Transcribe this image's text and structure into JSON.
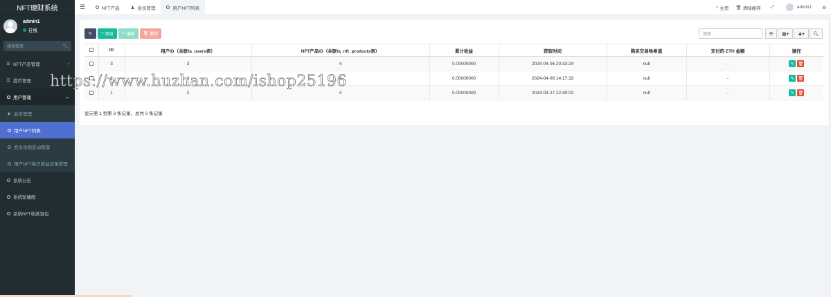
{
  "sidebar": {
    "logo": "NFT理财系统",
    "user": {
      "name": "admin1",
      "status": "在线"
    },
    "search_placeholder": "搜索菜单",
    "items": [
      {
        "label": "NFT产品管理"
      },
      {
        "label": "提币管理"
      },
      {
        "label": "用户管理"
      },
      {
        "label": "系统公告"
      },
      {
        "label": "系统轮播图"
      },
      {
        "label": "系统NFT收款钱包"
      }
    ],
    "submenu": [
      {
        "label": "会员管理"
      },
      {
        "label": "用户NFT列表"
      },
      {
        "label": "会员余额变动管理"
      },
      {
        "label": "用户NFT每日收益记录管理"
      }
    ]
  },
  "topbar": {
    "tabs": [
      {
        "label": "NFT产品"
      },
      {
        "label": "会员管理"
      },
      {
        "label": "用户NFT列表"
      }
    ],
    "home": "主页",
    "clear_cache": "清除缓存",
    "user": "admin1"
  },
  "toolbar": {
    "add": "添加",
    "edit": "编辑",
    "delete": "删除",
    "search_placeholder": "搜索"
  },
  "table": {
    "headers": [
      "ID",
      "用户ID（关联fa_users表）",
      "NFT产品ID（关联fa_nft_products表）",
      "累计收益",
      "获取时间",
      "购买交易哈希值",
      "支付的 ETH 金额",
      "操作"
    ],
    "rows": [
      {
        "id": "3",
        "user_id": "3",
        "product_id": "4",
        "earnings": "0.00000000",
        "time": "2024-04-06 20:33:24",
        "hash": "null",
        "eth": "-"
      },
      {
        "id": "2",
        "user_id": "3",
        "product_id": "4",
        "earnings": "0.00000000",
        "time": "2024-04-06 14:17:33",
        "hash": "null",
        "eth": "-"
      },
      {
        "id": "1",
        "user_id": "2",
        "product_id": "4",
        "earnings": "0.00000000",
        "time": "2024-03-27 22:49:02",
        "hash": "null",
        "eth": "-"
      }
    ]
  },
  "pagination_text": "显示第 1 到第 3 条记录，总共 3 条记录",
  "watermark": "https://www.huzhan.com/ishop25196",
  "colors": {
    "sidebar": "#222d32",
    "active": "#4f6fd1",
    "success": "#18bc9c",
    "danger": "#e74c3c"
  }
}
